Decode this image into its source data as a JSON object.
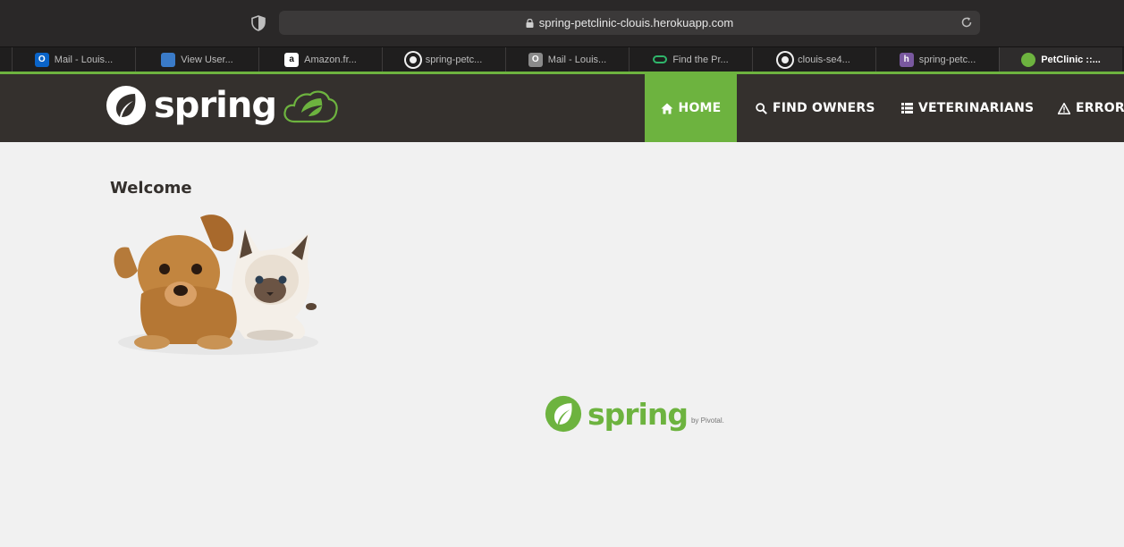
{
  "browser": {
    "url": "spring-petclinic-clouis.herokuapp.com",
    "tabs": [
      {
        "label": "Mail - Louis...",
        "icon": "outlook-icon",
        "color": "#0a64c8",
        "glyph": "O"
      },
      {
        "label": "View User...",
        "icon": "shield-badge-icon",
        "color": "#3a7bc8",
        "glyph": ""
      },
      {
        "label": "Amazon.fr...",
        "icon": "amazon-icon",
        "color": "#ffffff",
        "glyph": "a"
      },
      {
        "label": "spring-petc...",
        "icon": "github-icon",
        "color": "#ffffff",
        "glyph": ""
      },
      {
        "label": "Mail - Louis...",
        "icon": "mail-o-icon",
        "color": "#8a8a8a",
        "glyph": "O"
      },
      {
        "label": "Find the Pr...",
        "icon": "link-loop-icon",
        "color": "#2fb66b",
        "glyph": ""
      },
      {
        "label": "clouis-se4...",
        "icon": "github-icon",
        "color": "#ffffff",
        "glyph": ""
      },
      {
        "label": "spring-petc...",
        "icon": "heroku-icon",
        "color": "#79589f",
        "glyph": "h"
      },
      {
        "label": "PetClinic ::...",
        "icon": "spring-leaf-icon",
        "color": "#6db33f",
        "glyph": "",
        "active": true
      }
    ]
  },
  "navbar": {
    "brand": "spring",
    "items": [
      {
        "label": "HOME",
        "icon": "home-icon",
        "active": true
      },
      {
        "label": "FIND OWNERS",
        "icon": "search-icon"
      },
      {
        "label": "VETERINARIANS",
        "icon": "list-icon"
      },
      {
        "label": "ERROR",
        "icon": "warning-icon"
      }
    ]
  },
  "content": {
    "title": "Welcome"
  },
  "footer": {
    "brand": "spring",
    "by": "by Pivotal."
  },
  "colors": {
    "accent": "#6db33f",
    "navbar": "#34302d",
    "background": "#f1f1f1"
  }
}
